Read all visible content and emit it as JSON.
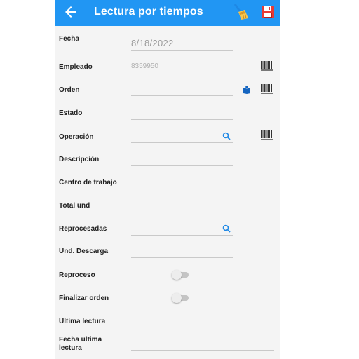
{
  "appbar": {
    "title": "Lectura por tiempos",
    "back_icon": "arrow-left-icon",
    "clear_icon": "broom-icon",
    "save_icon": "floppy-disk-icon",
    "color": "#2196f3"
  },
  "form": {
    "fecha": {
      "label": "Fecha",
      "value": "8/18/2022"
    },
    "empleado": {
      "label": "Empleado",
      "value": "8359950"
    },
    "orden": {
      "label": "Orden",
      "value": ""
    },
    "estado": {
      "label": "Estado",
      "value": ""
    },
    "operacion": {
      "label": "Operación",
      "value": ""
    },
    "descripcion": {
      "label": "Descripción",
      "value": ""
    },
    "centro": {
      "label": "Centro de trabajo",
      "value": ""
    },
    "total": {
      "label": "Total und",
      "value": ""
    },
    "reprocesadas": {
      "label": "Reprocesadas",
      "value": ""
    },
    "descarga": {
      "label": "Und. Descarga",
      "value": ""
    },
    "reproceso": {
      "label": "Reproceso",
      "on": false
    },
    "finalizar": {
      "label": "Finalizar orden",
      "on": false
    },
    "ultima": {
      "label": "Ultima lectura",
      "value": ""
    },
    "fecha_ultima": {
      "label_line1": "Fecha ultima",
      "label_line2": "lectura",
      "value": ""
    }
  }
}
